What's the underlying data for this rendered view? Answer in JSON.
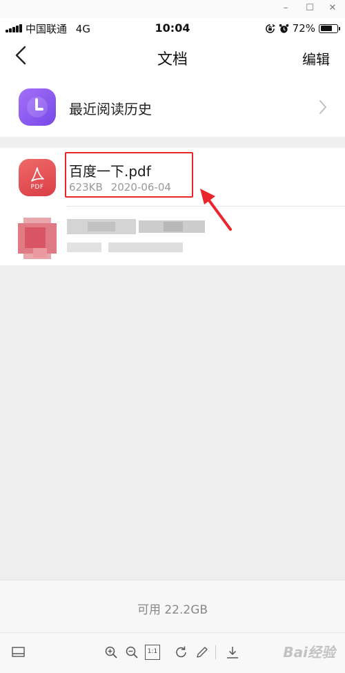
{
  "window_controls": {
    "minimize": "–",
    "maximize": "☐",
    "close": "✕"
  },
  "status_bar": {
    "carrier": "中国联通",
    "network": "4G",
    "time": "10:04",
    "battery_percent": "72%",
    "battery_level": 0.72,
    "icons": [
      "signal-icon",
      "rotation-lock-icon",
      "alarm-icon",
      "battery-icon"
    ]
  },
  "nav": {
    "back_icon": "chevron-left-icon",
    "title": "文档",
    "edit_label": "编辑"
  },
  "history": {
    "label": "最近阅读历史",
    "icon": "clock-icon",
    "chevron": "chevron-right-icon"
  },
  "files": [
    {
      "name": "百度一下.pdf",
      "size": "623KB",
      "date": "2020-06-04",
      "icon_label": "PDF",
      "icon": "acrobat-pdf-icon"
    }
  ],
  "storage": {
    "label": "可用 22.2GB"
  },
  "toolbar": {
    "icons": [
      "sidebar-icon",
      "zoom-in-icon",
      "zoom-out-icon",
      "actual-size-icon",
      "rotate-icon",
      "pencil-icon",
      "download-icon"
    ],
    "actual_size_label": "1:1"
  },
  "watermark": "Bai经验",
  "colors": {
    "history_icon": "#8a5cf0",
    "pdf_icon": "#e04c54",
    "annotation": "#e8262b",
    "background": "#efefef"
  }
}
